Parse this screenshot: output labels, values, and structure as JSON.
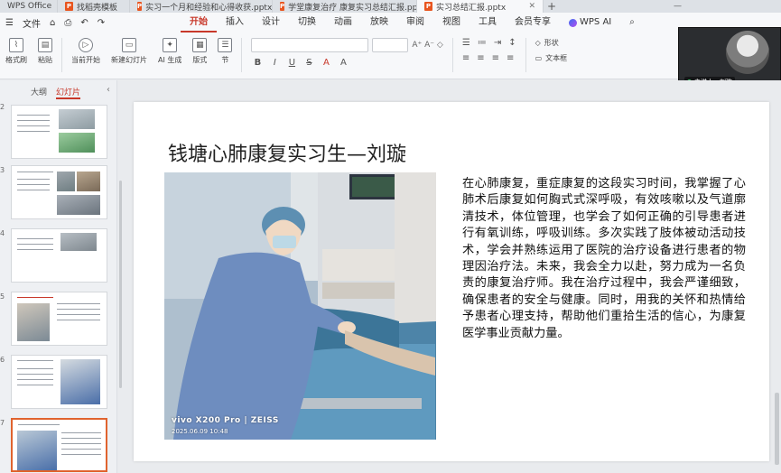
{
  "tabs": [
    {
      "label": "WPS Office",
      "icon": "wps-logo"
    },
    {
      "label": "找稻壳模板",
      "icon": "doc-icon"
    },
    {
      "label": "实习一个月和经验和心得收获.pptx",
      "icon": "doc-icon"
    },
    {
      "label": "学堂康复治疗 康复实习总结汇报.pptx",
      "icon": "doc-icon"
    },
    {
      "label": "实习总结汇报.pptx",
      "icon": "doc-icon",
      "active": true
    }
  ],
  "menubar": {
    "left_items": [
      "文件",
      "⌂",
      "⎙",
      "↶",
      "↷"
    ],
    "menus": [
      "开始",
      "插入",
      "设计",
      "切换",
      "动画",
      "放映",
      "审阅",
      "视图",
      "工具",
      "会员专享",
      "WPS AI"
    ],
    "active_menu": "开始"
  },
  "ribbon": {
    "buttons": [
      "格式刷",
      "粘贴",
      "当前开始",
      "新建幻灯片",
      "AI 生成",
      "版式",
      "节"
    ],
    "format_marks": [
      "B",
      "I",
      "U",
      "S",
      "A",
      "A"
    ],
    "right_buttons": [
      "形状",
      "文本框"
    ]
  },
  "video": {
    "label": "主讲人—刘璇"
  },
  "left_panel": {
    "tabs": [
      "大纲",
      "幻灯片"
    ],
    "active_tab": "幻灯片",
    "thumb_numbers": [
      "2",
      "3",
      "4",
      "5",
      "6",
      "7"
    ]
  },
  "slide": {
    "title": "钱塘心肺康复实习生—刘璇",
    "body": "在心肺康复，重症康复的这段实习时间，我掌握了心肺术后康复如何胸式式深呼吸，有效咳嗽以及气道廓清技术，体位管理，也学会了如何正确的引导患者进行有氧训练，呼吸训练。多次实践了肢体被动活动技术，学会并熟练运用了医院的治疗设备进行患者的物理因治疗法。未来，我会全力以赴，努力成为一名负责的康复治疗师。我在治疗过程中，我会严谨细致，确保患者的安全与健康。同时，用我的关怀和热情给予患者心理支持，帮助他们重拾生活的信心，为康复医学事业贡献力量。",
    "photo_watermark": "vivo X200 Pro | ZEISS",
    "photo_timestamp": "2025.06.09 10:48"
  },
  "colors": {
    "accent": "#c8382a",
    "selection": "#e0632e"
  }
}
